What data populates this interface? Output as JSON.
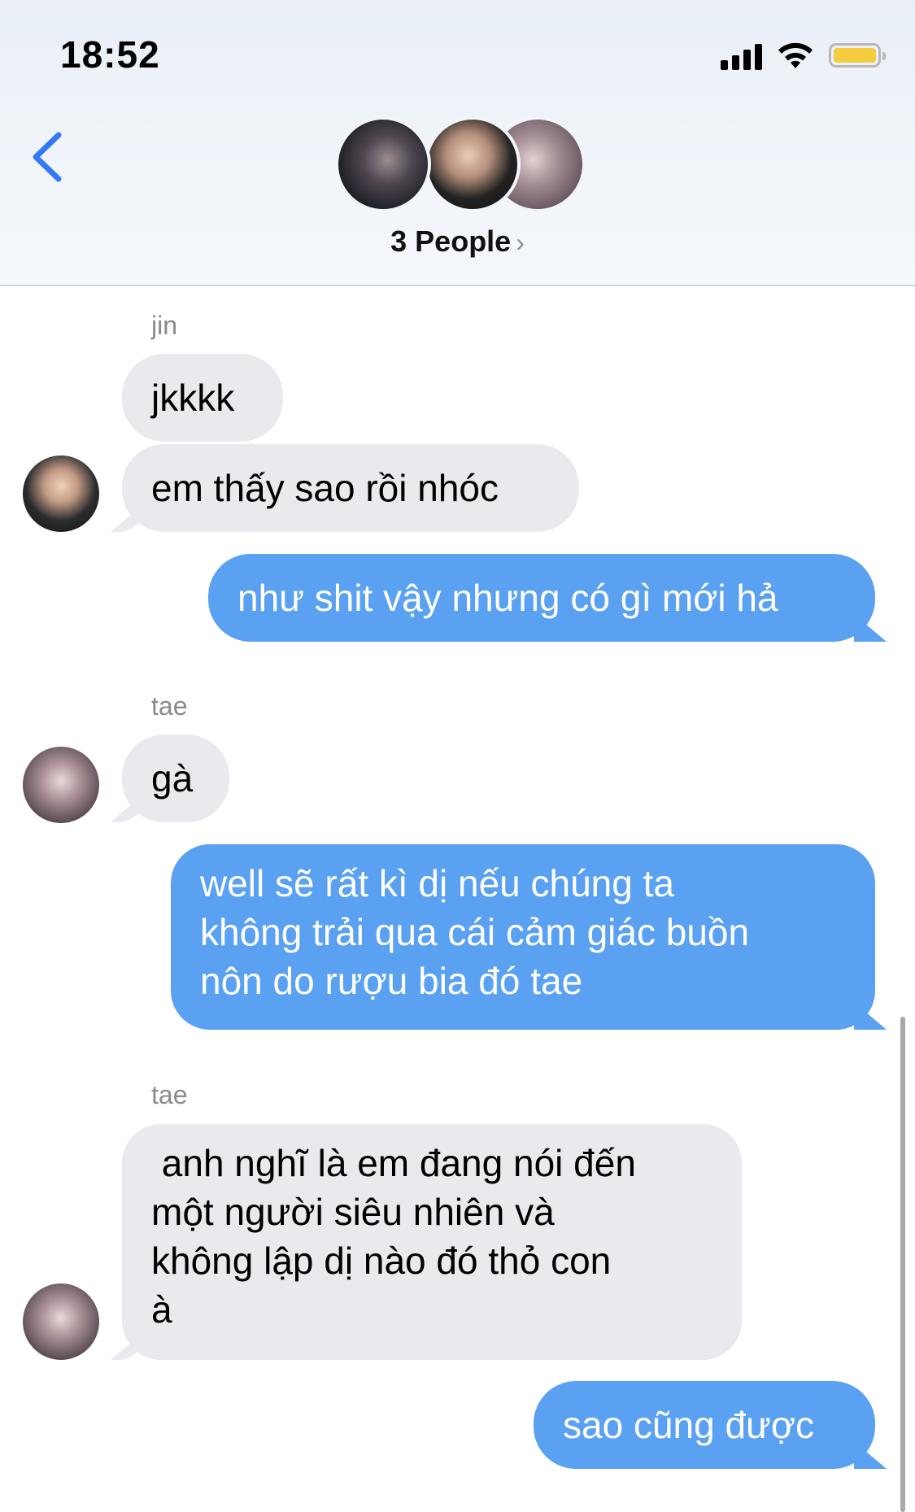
{
  "status_bar": {
    "time": "18:52",
    "battery_color": "#f5cc3f"
  },
  "header": {
    "back_icon": "chevron-left-icon",
    "title": "3 People",
    "title_chevron": "›"
  },
  "colors": {
    "incoming_bubble": "#e9e9ee",
    "outgoing_bubble": "#5aa1f2",
    "accent": "#3478f6"
  },
  "messages": [
    {
      "sender": "jin",
      "direction": "in",
      "text": "jkkkk"
    },
    {
      "direction": "in",
      "text": "em thấy sao rồi nhóc"
    },
    {
      "direction": "out",
      "text": "như shit vậy nhưng có gì mới hả"
    },
    {
      "sender": "tae",
      "direction": "in",
      "text": "gà"
    },
    {
      "direction": "out",
      "lines": [
        "well sẽ rất kì dị nếu chúng ta",
        "không trải qua cái cảm giác buồn",
        "nôn do rượu bia đó tae"
      ]
    },
    {
      "sender": "tae",
      "direction": "in",
      "lines": [
        " anh nghĩ là em đang nói đến",
        "một người siêu nhiên và",
        "không lập dị nào đó thỏ con",
        "à"
      ]
    },
    {
      "direction": "out",
      "text": "sao cũng được"
    }
  ]
}
